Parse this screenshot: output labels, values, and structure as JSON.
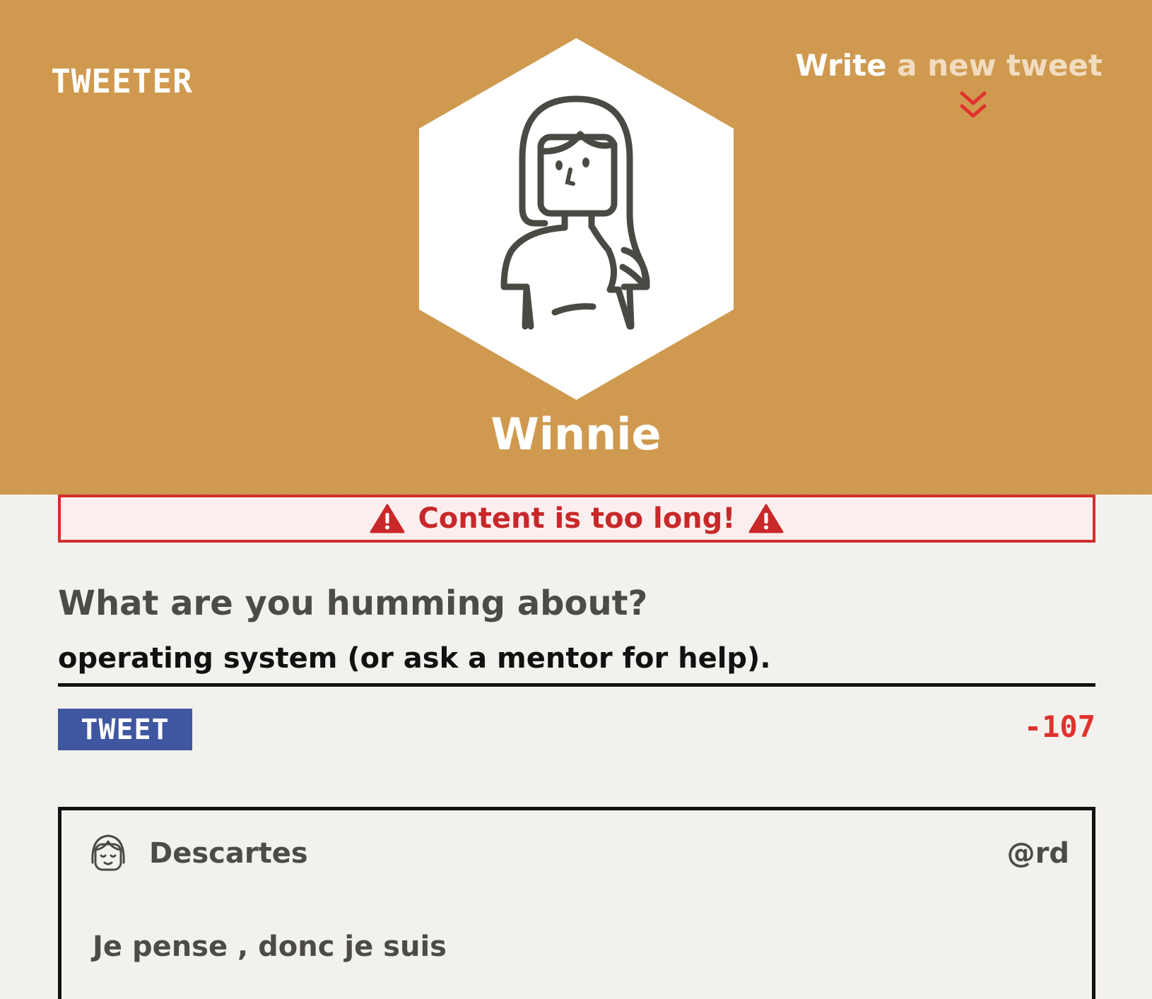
{
  "colors": {
    "header_bg": "#cf9a4f",
    "page_bg": "#f3f1ed",
    "error": "#d0302c",
    "tweet_button": "#3f56a0",
    "counter": "#e0322e"
  },
  "nav": {
    "brand": "TWEETER",
    "write_strong": "Write",
    "write_rest": " a new tweet",
    "chevron_icon": "double-chevron-down-icon"
  },
  "profile": {
    "name": "Winnie",
    "avatar_icon": "woman-avatar-icon"
  },
  "error": {
    "message": "Content is too long!",
    "icon": "warning-triangle-icon"
  },
  "composer": {
    "prompt": "What are you humming about?",
    "value": "operating system (or ask a mentor for help).",
    "button_label": "TWEET",
    "counter": "-107"
  },
  "tweets": [
    {
      "author": "Descartes",
      "handle": "@rd",
      "content": "Je pense , donc je suis",
      "avatar_icon": "smiling-face-avatar-icon"
    }
  ]
}
